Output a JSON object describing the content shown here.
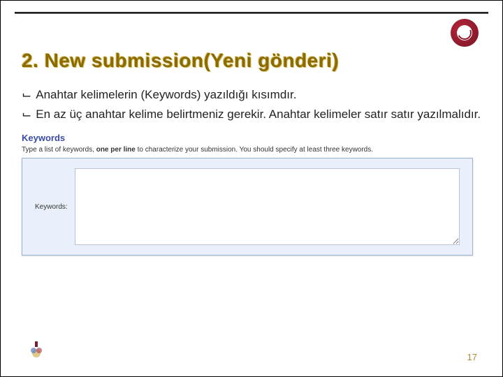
{
  "title": "2. New submission(Yeni gönderi)",
  "bullets": [
    "Anahtar kelimelerin (Keywords) yazıldığı kısımdır.",
    "En az üç anahtar kelime belirtmeniz gerekir. Anahtar kelimeler satır satır yazılmalıdır."
  ],
  "keywords_panel": {
    "heading": "Keywords",
    "description_prefix": "Type a list of keywords, ",
    "description_bold": "one per line",
    "description_suffix": " to characterize your submission. You should specify at least three keywords.",
    "label": "Keywords:",
    "textarea_value": ""
  },
  "page_number": "17"
}
